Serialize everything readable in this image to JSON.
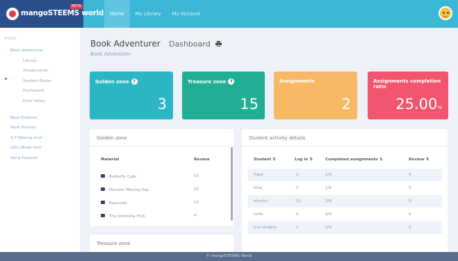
{
  "header": {
    "brand_name": "mangoSTEEMS world",
    "brand_badge": "BETA",
    "nav": [
      "Home",
      "My Library",
      "My Account"
    ]
  },
  "sidebar": {
    "section_label": "MODE",
    "items": [
      {
        "label": "Book Adventurer",
        "sub": false
      },
      {
        "label": "Library",
        "sub": true
      },
      {
        "label": "Assignments",
        "sub": true
      },
      {
        "label": "Student Roster",
        "sub": true
      },
      {
        "label": "Dashboard",
        "sub": true
      },
      {
        "label": "Echo Valley",
        "sub": true
      },
      {
        "label": "Book Explorer",
        "sub": false
      },
      {
        "label": "Book Pioneer",
        "sub": false
      },
      {
        "label": "G.T Wisong lmol",
        "sub": false
      },
      {
        "label": "LAO eBook lmol",
        "sub": false
      },
      {
        "label": "Song Explorer",
        "sub": false
      }
    ]
  },
  "page": {
    "title": "Book Adventurer",
    "subtitle": "Dashboard",
    "breadcrumb": "Book Adventurer"
  },
  "cards": [
    {
      "label": "Golden zone",
      "value": "3",
      "unit": "",
      "info": true,
      "color": "#2cb5c3"
    },
    {
      "label": "Treasure zone",
      "value": "15",
      "unit": "",
      "info": true,
      "color": "#20af95"
    },
    {
      "label": "Assignments",
      "value": "2",
      "unit": "",
      "info": false,
      "color": "#f7b965"
    },
    {
      "label": "Assignments completion ratio",
      "value": "25.00",
      "unit": "%",
      "info": false,
      "color": "#f2556f"
    }
  ],
  "golden_zone": {
    "title": "Golden zone",
    "columns": [
      "Material",
      "Review"
    ],
    "rows": [
      {
        "material": "Butterfly Cafe",
        "review": "53"
      },
      {
        "material": "Monster Moving Day",
        "review": "15"
      },
      {
        "material": "Rapunzel",
        "review": "11"
      },
      {
        "material": "The Umbrella Trick",
        "review": "4"
      }
    ]
  },
  "treasure_zone": {
    "title": "Treasure zone"
  },
  "student_activity": {
    "title": "Student activity details",
    "columns": [
      "Student",
      "Log in",
      "Completed assignments",
      "Review"
    ],
    "rows": [
      {
        "student": "Tiger",
        "login": "2",
        "completed": "1/5",
        "review": "0"
      },
      {
        "student": "blue",
        "login": "1",
        "completed": "1/6",
        "review": "0"
      },
      {
        "student": "shushu",
        "login": "12",
        "completed": "3/8",
        "review": "0"
      },
      {
        "student": "hello",
        "login": "0",
        "completed": "0/0",
        "review": "0"
      },
      {
        "student": "kris student",
        "login": "1",
        "completed": "0/9",
        "review": "0"
      }
    ]
  },
  "footer": {
    "text": "© mangoSTEEMS World"
  }
}
